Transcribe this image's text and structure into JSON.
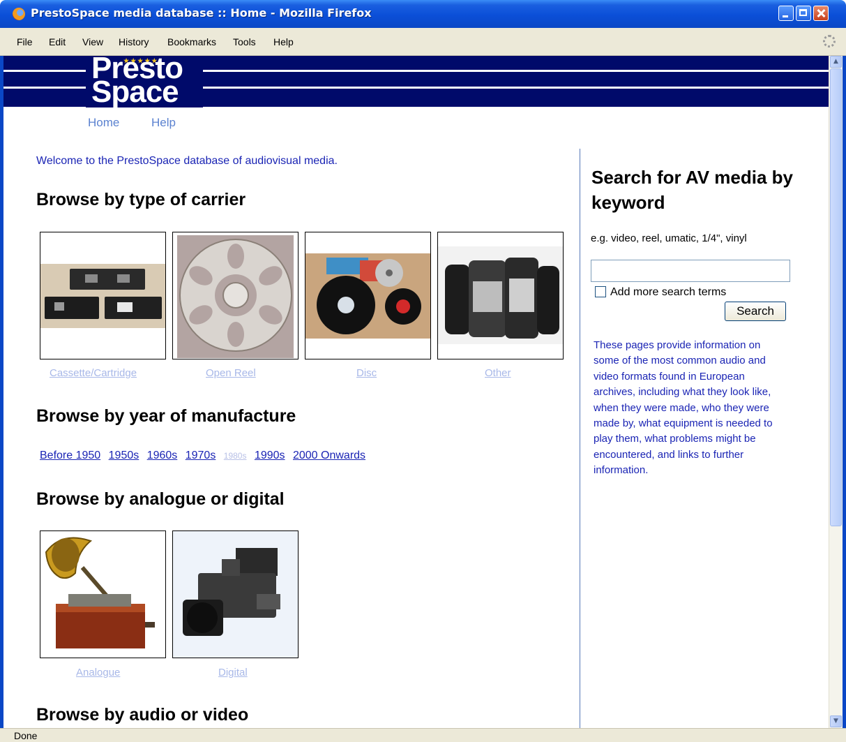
{
  "window": {
    "title": "PrestoSpace media database :: Home - Mozilla Firefox"
  },
  "menu": {
    "items": [
      "File",
      "Edit",
      "View",
      "History",
      "Bookmarks",
      "Tools",
      "Help"
    ]
  },
  "logo": {
    "line1": "Presto",
    "line2": "Space"
  },
  "nav": {
    "home": "Home",
    "help": "Help"
  },
  "main": {
    "welcome": "Welcome to the PrestoSpace database of audiovisual media.",
    "carrier_heading": "Browse by type of carrier",
    "carriers": [
      {
        "label": "Cassette/Cartridge",
        "icon": "video-cassette-image"
      },
      {
        "label": "Open Reel",
        "icon": "film-reel-image"
      },
      {
        "label": "Disc",
        "icon": "disc-image"
      },
      {
        "label": "Other",
        "icon": "cylinder-image"
      }
    ],
    "year_heading": "Browse by year of manufacture",
    "years": [
      "Before 1950",
      "1950s",
      "1960s",
      "1970s",
      "1980s",
      "1990s",
      "2000 Onwards"
    ],
    "analogue_heading": "Browse by analogue or digital",
    "analogue_items": [
      {
        "label": "Analogue",
        "icon": "phonograph-image"
      },
      {
        "label": "Digital",
        "icon": "camcorder-image"
      }
    ],
    "audio_video_heading": "Browse by audio or video"
  },
  "sidebar": {
    "title": "Search for AV media by keyword",
    "example": "e.g. video, reel, umatic, 1/4\", vinyl",
    "search_value": "",
    "add_terms_label": "Add more search terms",
    "search_button": "Search",
    "description": "These pages provide information on some of the most common audio and video formats found in European archives, including what they look like, when they were made, who they were made by, what equipment is needed to play them, what problems might be encountered, and links to further information."
  },
  "status": {
    "text": "Done"
  },
  "colors": {
    "banner": "#000a6a",
    "link": "#1a24b4",
    "visited_link": "#a8b8e8",
    "titlebar": "#0b4fd8"
  }
}
